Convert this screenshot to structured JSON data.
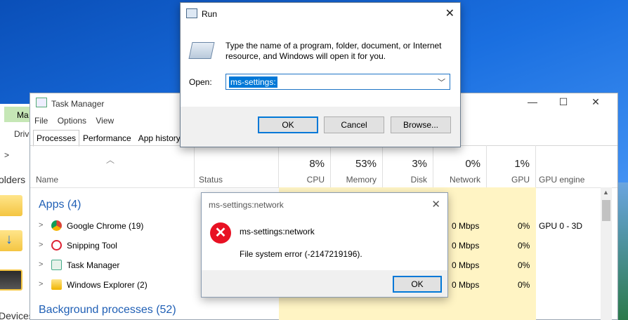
{
  "explorer": {
    "ribbon_tab": "Ma",
    "drive_label": "Drive",
    "chevron": ">",
    "folders_label": "olders",
    "devices_label": "Devices"
  },
  "task_manager": {
    "title": "Task Manager",
    "menu": [
      "File",
      "Options",
      "View"
    ],
    "tabs": [
      "Processes",
      "Performance",
      "App history"
    ],
    "active_tab": "Processes",
    "columns": {
      "name": "Name",
      "status": "Status",
      "cpu": {
        "pct": "8%",
        "label": "CPU"
      },
      "memory": {
        "pct": "53%",
        "label": "Memory"
      },
      "disk": {
        "pct": "3%",
        "label": "Disk"
      },
      "network": {
        "pct": "0%",
        "label": "Network"
      },
      "gpu": {
        "pct": "1%",
        "label": "GPU"
      },
      "gpu_engine": "GPU engine"
    },
    "apps_section": "Apps (4)",
    "bg_section": "Background processes (52)",
    "rows": [
      {
        "name": "Google Chrome (19)",
        "network": "0 Mbps",
        "gpu": "0%",
        "gpu_engine": "GPU 0 - 3D"
      },
      {
        "name": "Snipping Tool",
        "network": "0 Mbps",
        "gpu": "0%",
        "gpu_engine": ""
      },
      {
        "name": "Task Manager",
        "network": "0 Mbps",
        "gpu": "0%",
        "gpu_engine": ""
      },
      {
        "name": "Windows Explorer (2)",
        "network": "0 Mbps",
        "gpu": "0%",
        "gpu_engine": ""
      }
    ]
  },
  "run_dialog": {
    "title": "Run",
    "message": "Type the name of a program, folder, document, or Internet resource, and Windows will open it for you.",
    "open_label": "Open:",
    "open_value": "ms-settings:",
    "ok": "OK",
    "cancel": "Cancel",
    "browse": "Browse..."
  },
  "error_dialog": {
    "title": "ms-settings:network",
    "heading": "ms-settings:network",
    "message": "File system error (-2147219196).",
    "ok": "OK"
  },
  "colors": {
    "accent": "#0078d7",
    "error": "#e81123",
    "section": "#1f5fb5",
    "heat": "#fff4c4"
  }
}
